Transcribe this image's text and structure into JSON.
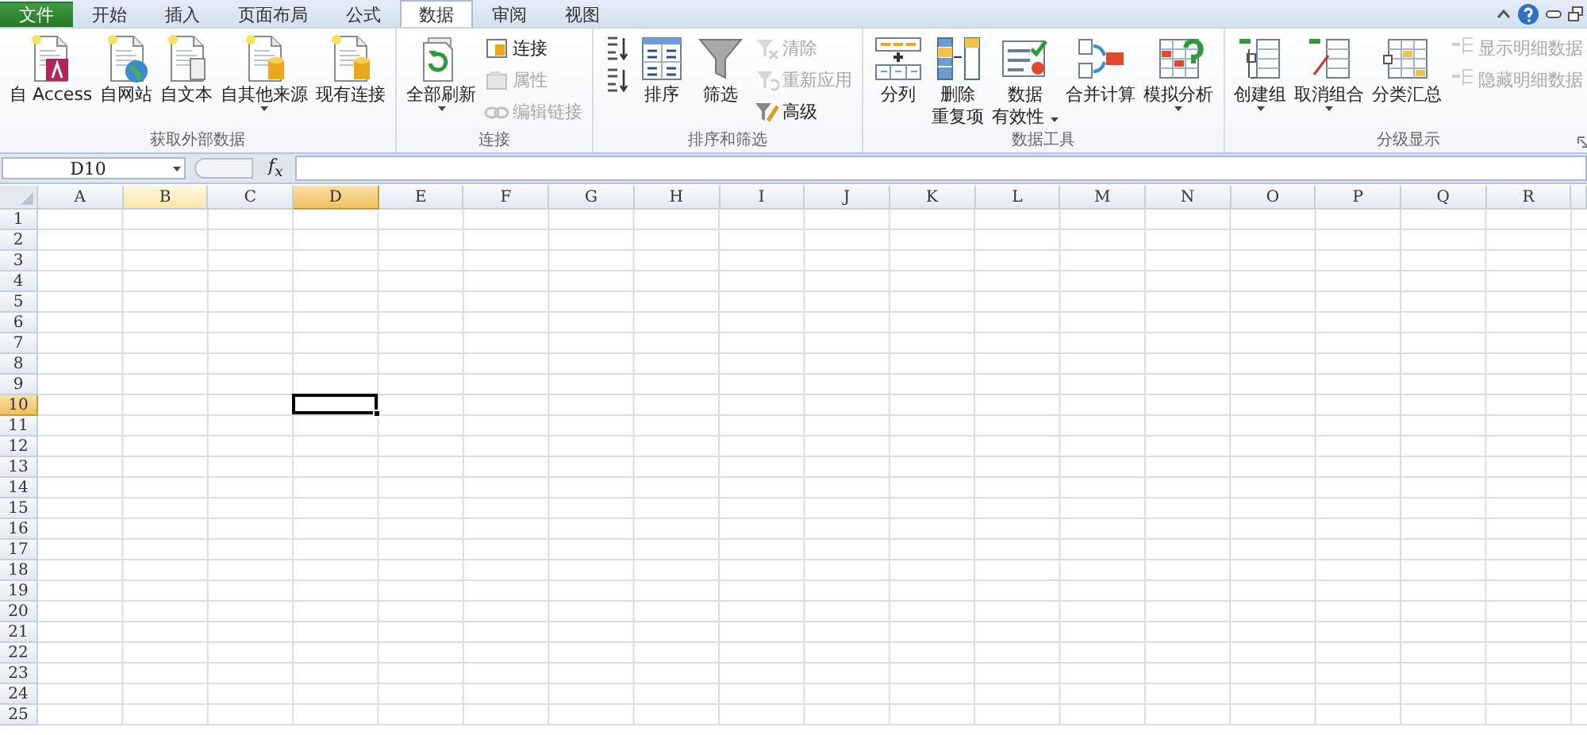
{
  "tabs": [
    {
      "label": "文件",
      "kind": "file",
      "selected": false
    },
    {
      "label": "开始",
      "kind": "tab",
      "selected": false
    },
    {
      "label": "插入",
      "kind": "tab",
      "selected": false
    },
    {
      "label": "页面布局",
      "kind": "tab",
      "selected": false
    },
    {
      "label": "公式",
      "kind": "tab",
      "selected": false
    },
    {
      "label": "数据",
      "kind": "tab",
      "selected": true
    },
    {
      "label": "审阅",
      "kind": "tab",
      "selected": false
    },
    {
      "label": "视图",
      "kind": "tab",
      "selected": false
    }
  ],
  "ribbon": {
    "groups": [
      {
        "label": "获取外部数据",
        "launcher": false,
        "items": [
          {
            "kind": "large",
            "lines": [
              "自 Access"
            ],
            "dropdown": false
          },
          {
            "kind": "large",
            "lines": [
              "自网站"
            ],
            "dropdown": false
          },
          {
            "kind": "large",
            "lines": [
              "自文本"
            ],
            "dropdown": false
          },
          {
            "kind": "large",
            "lines": [
              "自其他来源"
            ],
            "dropdown": true
          },
          {
            "kind": "large",
            "lines": [
              "现有连接"
            ],
            "dropdown": false
          }
        ]
      },
      {
        "label": "连接",
        "launcher": false,
        "items": [
          {
            "kind": "large",
            "lines": [
              "全部刷新"
            ],
            "dropdown": true
          },
          {
            "kind": "small",
            "label": "连接",
            "disabled": false
          },
          {
            "kind": "small",
            "label": "属性",
            "disabled": true
          },
          {
            "kind": "small",
            "label": "编辑链接",
            "disabled": true
          }
        ]
      },
      {
        "label": "排序和筛选",
        "launcher": false,
        "items": [
          {
            "kind": "small",
            "disabled": false
          },
          {
            "kind": "small",
            "disabled": false
          },
          {
            "kind": "large",
            "lines": [
              "排序"
            ],
            "dropdown": false
          },
          {
            "kind": "large",
            "lines": [
              "筛选"
            ],
            "dropdown": false
          },
          {
            "kind": "small",
            "label": "清除",
            "disabled": true
          },
          {
            "kind": "small",
            "label": "重新应用",
            "disabled": true
          },
          {
            "kind": "small",
            "label": "高级",
            "disabled": false
          }
        ]
      },
      {
        "label": "数据工具",
        "launcher": false,
        "items": [
          {
            "kind": "large",
            "lines": [
              "分列"
            ],
            "dropdown": false
          },
          {
            "kind": "large",
            "lines": [
              "删除",
              "重复项"
            ],
            "dropdown": false
          },
          {
            "kind": "large",
            "lines": [
              "数据",
              "有效性"
            ],
            "dropdown": true
          },
          {
            "kind": "large",
            "lines": [
              "合并计算"
            ],
            "dropdown": false
          },
          {
            "kind": "large",
            "lines": [
              "模拟分析"
            ],
            "dropdown": true
          }
        ]
      },
      {
        "label": "分级显示",
        "launcher": true,
        "items": [
          {
            "kind": "large",
            "lines": [
              "创建组"
            ],
            "dropdown": true
          },
          {
            "kind": "large",
            "lines": [
              "取消组合"
            ],
            "dropdown": true
          },
          {
            "kind": "large",
            "lines": [
              "分类汇总"
            ],
            "dropdown": false
          },
          {
            "kind": "small",
            "label": "显示明细数据",
            "disabled": true
          },
          {
            "kind": "small",
            "label": "隐藏明细数据",
            "disabled": true
          }
        ]
      }
    ]
  },
  "formula_bar": {
    "name_box": "D10",
    "fx": "f$_{x}$"
  },
  "grid": {
    "columns": [
      {
        "label": "A",
        "selected": false,
        "hovered": false
      },
      {
        "label": "B",
        "selected": false,
        "hovered": true
      },
      {
        "label": "C",
        "selected": false,
        "hovered": false
      },
      {
        "label": "D",
        "selected": true,
        "hovered": false
      },
      {
        "label": "E",
        "selected": false,
        "hovered": false
      },
      {
        "label": "F",
        "selected": false,
        "hovered": false
      },
      {
        "label": "G",
        "selected": false,
        "hovered": false
      },
      {
        "label": "H",
        "selected": false,
        "hovered": false
      },
      {
        "label": "I",
        "selected": false,
        "hovered": false
      },
      {
        "label": "J",
        "selected": false,
        "hovered": false
      },
      {
        "label": "K",
        "selected": false,
        "hovered": false
      },
      {
        "label": "L",
        "selected": false,
        "hovered": false
      },
      {
        "label": "M",
        "selected": false,
        "hovered": false
      },
      {
        "label": "N",
        "selected": false,
        "hovered": false
      },
      {
        "label": "O",
        "selected": false,
        "hovered": false
      },
      {
        "label": "P",
        "selected": false,
        "hovered": false
      },
      {
        "label": "Q",
        "selected": false,
        "hovered": false
      },
      {
        "label": "R",
        "selected": false,
        "hovered": false
      }
    ],
    "rows": [
      {
        "label": "1",
        "selected": false
      },
      {
        "label": "2",
        "selected": false
      },
      {
        "label": "3",
        "selected": false
      },
      {
        "label": "4",
        "selected": false
      },
      {
        "label": "5",
        "selected": false
      },
      {
        "label": "6",
        "selected": false
      },
      {
        "label": "7",
        "selected": false
      },
      {
        "label": "8",
        "selected": false
      },
      {
        "label": "9",
        "selected": false
      },
      {
        "label": "10",
        "selected": true
      },
      {
        "label": "11",
        "selected": false
      },
      {
        "label": "12",
        "selected": false
      },
      {
        "label": "13",
        "selected": false
      },
      {
        "label": "14",
        "selected": false
      },
      {
        "label": "15",
        "selected": false
      },
      {
        "label": "16",
        "selected": false
      },
      {
        "label": "17",
        "selected": false
      },
      {
        "label": "18",
        "selected": false
      },
      {
        "label": "19",
        "selected": false
      },
      {
        "label": "20",
        "selected": false
      },
      {
        "label": "21",
        "selected": false
      },
      {
        "label": "22",
        "selected": false
      },
      {
        "label": "23",
        "selected": false
      },
      {
        "label": "24",
        "selected": false
      },
      {
        "label": "25",
        "selected": false
      }
    ]
  }
}
